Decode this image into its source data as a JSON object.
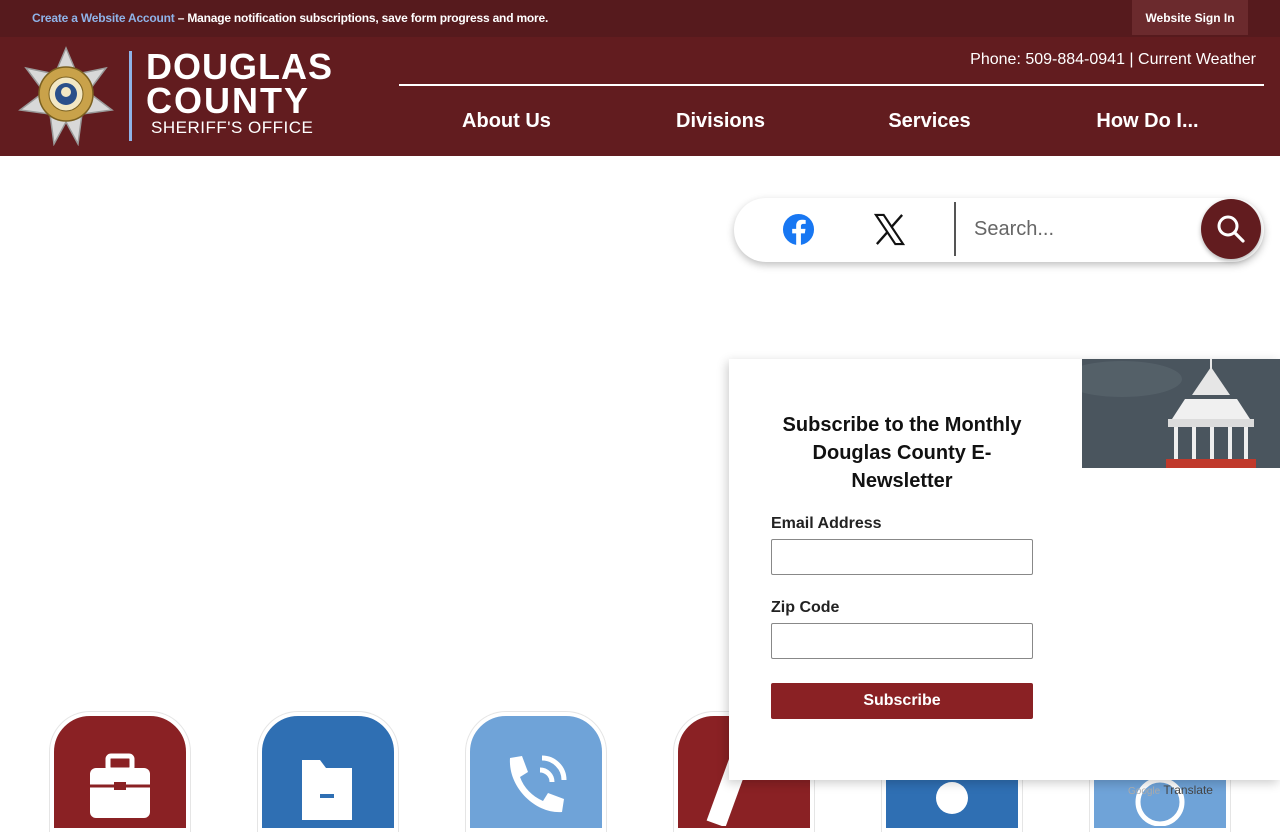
{
  "topbar": {
    "create_link": "Create a Website Account",
    "message": " – Manage notification subscriptions, save form progress and more.",
    "signin": "Website Sign In"
  },
  "header": {
    "brand_line1": "DOUGLAS",
    "brand_line2": "COUNTY",
    "brand_line3": "SHERIFF'S OFFICE",
    "contact": "Phone: 509-884-0941 | Current Weather",
    "nav": [
      "About Us",
      "Divisions",
      "Services",
      "How Do I..."
    ]
  },
  "search": {
    "placeholder": "Search..."
  },
  "icons": {
    "facebook": "facebook-icon",
    "x": "x-logo-icon",
    "search": "search-icon"
  },
  "colors": {
    "maroon_dark": "#561a1d",
    "maroon": "#621c1f",
    "accent_blue": "#8fb3e8",
    "tile_red": "#8a2124",
    "tile_blue": "#2f6fb3",
    "tile_light_blue": "#6fa3d8",
    "facebook_blue": "#1877f2"
  },
  "newsletter": {
    "title": "Subscribe to the Monthly Douglas County E-Newsletter",
    "email_label": "Email Address",
    "zip_label": "Zip Code",
    "button": "Subscribe"
  },
  "translate": {
    "google": "Google",
    "label": "Translate"
  }
}
